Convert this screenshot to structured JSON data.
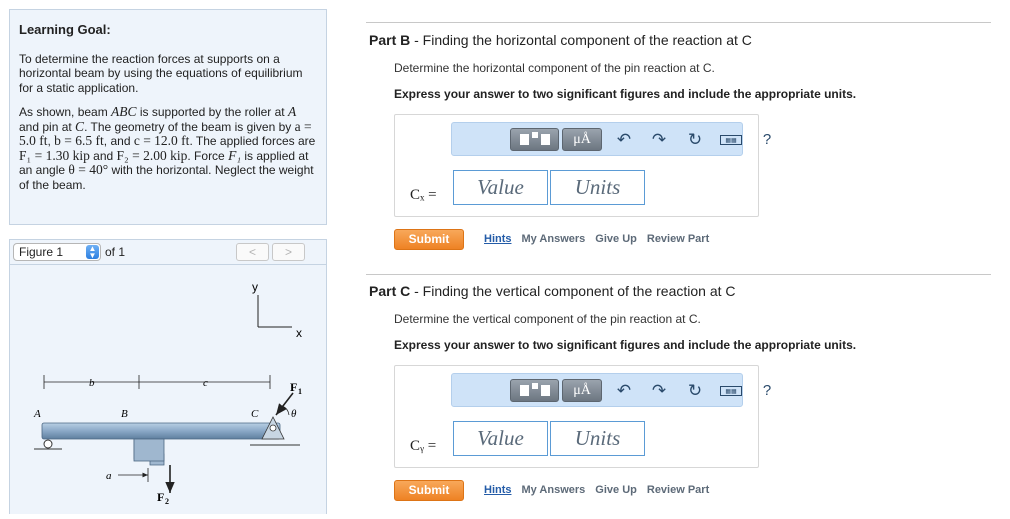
{
  "goal": {
    "heading": "Learning Goal:",
    "objective": "To determine the reaction forces at supports on a horizontal beam by using the equations of equilibrium for a static application.",
    "p_as_shown": "As shown, beam ",
    "abc": "ABC",
    "p_supported": " is supported by the roller at ",
    "a": "A",
    "p_and_pin": " and pin at ",
    "c": "C",
    "p_geometry": ". The geometry of the beam is given by ",
    "a_eq": "a = 5.0 ft",
    "comma1": ", ",
    "b_eq": "b = 6.5 ft",
    "and_c": ", and ",
    "c_eq": "c = 12.0 ft",
    "p_forces": ". The applied forces are ",
    "f1_eq": "F₁ = 1.30 kip",
    "and": " and ",
    "f2_eq": "F₂ = 2.00 kip",
    "p_force_f1": ". Force ",
    "f1": "F₁",
    "p_applied": " is applied at an angle ",
    "theta_eq": "θ = 40°",
    "p_tail": " with the horizontal. Neglect the weight of the beam."
  },
  "figure_bar": {
    "selected": "Figure 1",
    "of_label": "of 1",
    "prev": "<",
    "next": ">"
  },
  "figure": {
    "axis_y": "y",
    "axis_x": "x",
    "dim_b": "b",
    "dim_c": "c",
    "dim_a": "a",
    "pt_a": "A",
    "pt_b": "B",
    "pt_c": "C",
    "f1": "F",
    "f1_sub": "1",
    "f2": "F",
    "f2_sub": "2",
    "theta": "θ"
  },
  "toolbar_labels": {
    "mu": "μÅ",
    "help": "?"
  },
  "parts": [
    {
      "label": "Part B",
      "title": " - Finding the horizontal component of the reaction at C",
      "desc": "Determine the horizontal component of the pin reaction at C.",
      "express": "Express your answer to two significant figures and include the appropriate units.",
      "var": "Cₓ =",
      "value_ph": "Value",
      "units_ph": "Units",
      "submit": "Submit",
      "links": [
        "Hints",
        "My Answers",
        "Give Up",
        "Review Part"
      ]
    },
    {
      "label": "Part C",
      "title": " - Finding the vertical component of the reaction at C",
      "desc": "Determine the vertical component of the pin reaction at C.",
      "express": "Express your answer to two significant figures and include the appropriate units.",
      "var": "Cᵧ =",
      "value_ph": "Value",
      "units_ph": "Units",
      "submit": "Submit",
      "links": [
        "Hints",
        "My Answers",
        "Give Up",
        "Review Part"
      ]
    }
  ]
}
